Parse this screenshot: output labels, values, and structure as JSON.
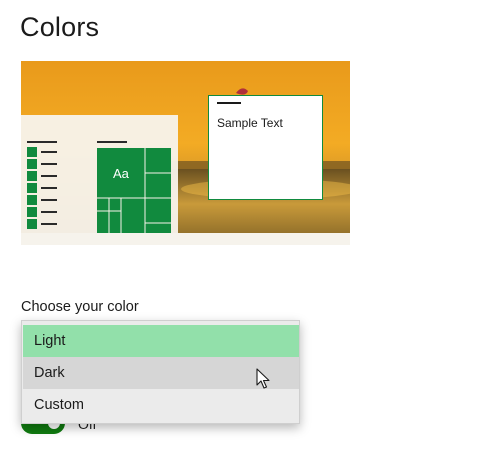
{
  "page": {
    "title": "Colors"
  },
  "preview": {
    "sample_text": "Sample Text",
    "tile_text": "Aa",
    "accent": "#0f8a3f"
  },
  "color_section": {
    "label": "Choose your color",
    "options": [
      {
        "label": "Light",
        "state": "selected"
      },
      {
        "label": "Dark",
        "state": "hover"
      },
      {
        "label": "Custom",
        "state": "normal"
      }
    ]
  },
  "toggle": {
    "label": "Off"
  },
  "icons": {
    "cursor": "mouse-pointer-icon"
  }
}
